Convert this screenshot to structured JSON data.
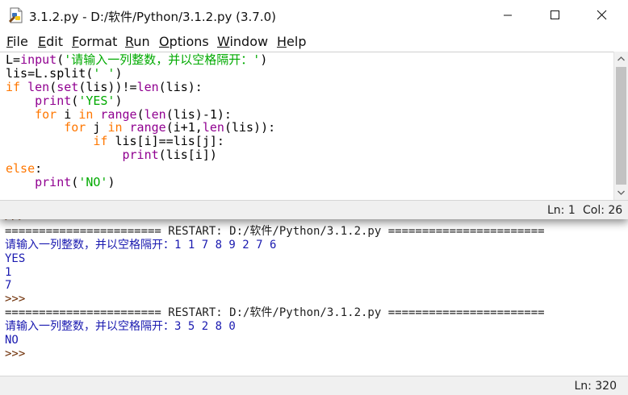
{
  "editor": {
    "title": "3.1.2.py - D:/软件/Python/3.1.2.py (3.7.0)",
    "menu": {
      "file": [
        "F",
        "ile"
      ],
      "edit": [
        "E",
        "dit"
      ],
      "format": [
        "F",
        "ormat"
      ],
      "run": [
        "R",
        "un"
      ],
      "options": [
        "O",
        "ptions"
      ],
      "window": [
        "W",
        "indow"
      ],
      "help": [
        "H",
        "elp"
      ]
    },
    "code": [
      [
        [
          "df",
          "L="
        ],
        [
          "bi",
          "input"
        ],
        [
          "df",
          "("
        ],
        [
          "st",
          "'请输入一列整数，并以空格隔开：'"
        ],
        [
          "df",
          ")"
        ]
      ],
      [
        [
          "df",
          "lis=L.split("
        ],
        [
          "st",
          "' '"
        ],
        [
          "df",
          ")"
        ]
      ],
      [
        [
          "kw",
          "if"
        ],
        [
          "df",
          " "
        ],
        [
          "bi",
          "len"
        ],
        [
          "df",
          "("
        ],
        [
          "bi",
          "set"
        ],
        [
          "df",
          "(lis))!="
        ],
        [
          "bi",
          "len"
        ],
        [
          "df",
          "(lis):"
        ]
      ],
      [
        [
          "df",
          "    "
        ],
        [
          "bi",
          "print"
        ],
        [
          "df",
          "("
        ],
        [
          "st",
          "'YES'"
        ],
        [
          "df",
          ")"
        ]
      ],
      [
        [
          "df",
          "    "
        ],
        [
          "kw",
          "for"
        ],
        [
          "df",
          " i "
        ],
        [
          "kw",
          "in"
        ],
        [
          "df",
          " "
        ],
        [
          "bi",
          "range"
        ],
        [
          "df",
          "("
        ],
        [
          "bi",
          "len"
        ],
        [
          "df",
          "(lis)-1):"
        ]
      ],
      [
        [
          "df",
          "        "
        ],
        [
          "kw",
          "for"
        ],
        [
          "df",
          " j "
        ],
        [
          "kw",
          "in"
        ],
        [
          "df",
          " "
        ],
        [
          "bi",
          "range"
        ],
        [
          "df",
          "(i+1,"
        ],
        [
          "bi",
          "len"
        ],
        [
          "df",
          "(lis)):"
        ]
      ],
      [
        [
          "df",
          "            "
        ],
        [
          "kw",
          "if"
        ],
        [
          "df",
          " lis[i]==lis[j]:"
        ]
      ],
      [
        [
          "df",
          "                "
        ],
        [
          "bi",
          "print"
        ],
        [
          "df",
          "(lis[i])"
        ]
      ],
      [
        [
          "kw",
          "else"
        ],
        [
          "df",
          ":"
        ]
      ],
      [
        [
          "df",
          "    "
        ],
        [
          "bi",
          "print"
        ],
        [
          "df",
          "("
        ],
        [
          "st",
          "'NO'"
        ],
        [
          "df",
          ")"
        ]
      ]
    ],
    "status": {
      "line": "Ln: 1",
      "col": "Col: 26"
    }
  },
  "shell": {
    "lines": [
      {
        "type": "prompt",
        "text": ">>>"
      },
      {
        "type": "restart",
        "text": "======================= RESTART: D:/软件/Python/3.1.2.py ======================="
      },
      {
        "type": "stdout",
        "text": "请输入一列整数，并以空格隔开：1 1 7 8 9 2 7 6"
      },
      {
        "type": "stdout",
        "text": "YES"
      },
      {
        "type": "stdout",
        "text": "1"
      },
      {
        "type": "stdout",
        "text": "7"
      },
      {
        "type": "prompt",
        "text": ">>>"
      },
      {
        "type": "restart",
        "text": "======================= RESTART: D:/软件/Python/3.1.2.py ======================="
      },
      {
        "type": "stdout",
        "text": "请输入一列整数，并以空格隔开：3 5 2 8 0"
      },
      {
        "type": "stdout",
        "text": "NO"
      },
      {
        "type": "prompt",
        "text": ">>>"
      }
    ],
    "status": {
      "line": "Ln: 320"
    }
  },
  "icons": {
    "app": "idle-python-file-icon",
    "minimize": "minimize-icon",
    "maximize": "maximize-icon",
    "close": "close-icon",
    "scroll_up": "chevron-up-icon",
    "scroll_down": "chevron-down-icon"
  },
  "colors": {
    "keyword": "#ff7700",
    "builtin": "#900090",
    "string": "#00aa00",
    "shell_stdout": "#1a1ab0",
    "shell_prompt": "#6b2a00"
  }
}
